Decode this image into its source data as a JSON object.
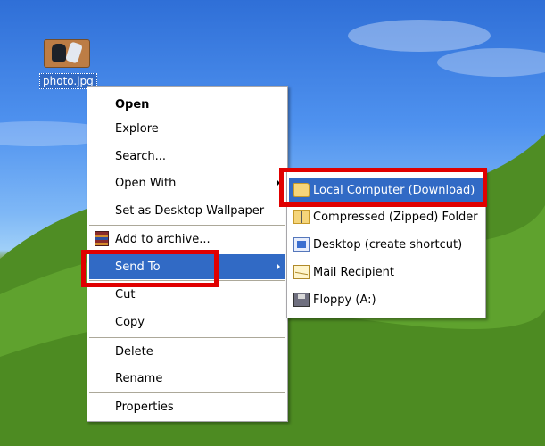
{
  "desktop_icon": {
    "label": "photo.jpg",
    "icon": "photo-thumbnail-icon"
  },
  "context_menu": {
    "items": [
      {
        "label": "Open",
        "bold": true
      },
      {
        "label": "Explore"
      },
      {
        "label": "Search..."
      },
      {
        "label": "Open With",
        "submenu": true
      },
      {
        "label": "Set as Desktop Wallpaper"
      },
      {
        "label": "Add to archive...",
        "icon": "winrar-archive-icon"
      },
      {
        "label": "Send To",
        "submenu": true,
        "highlighted": true
      },
      {
        "label": "Cut"
      },
      {
        "label": "Copy"
      },
      {
        "label": "Delete"
      },
      {
        "label": "Rename"
      },
      {
        "label": "Properties"
      }
    ]
  },
  "send_to_menu": {
    "items": [
      {
        "label": "Local Computer (Download)",
        "icon": "folder-icon",
        "highlighted": true
      },
      {
        "label": "Compressed (Zipped) Folder",
        "icon": "zip-folder-icon"
      },
      {
        "label": "Desktop (create shortcut)",
        "icon": "desktop-icon"
      },
      {
        "label": "Mail Recipient",
        "icon": "mail-icon"
      },
      {
        "label": "Floppy (A:)",
        "icon": "floppy-drive-icon"
      }
    ]
  },
  "colors": {
    "highlight": "#316ac5",
    "annotation_red": "#e00000",
    "menu_background": "#ffffff"
  }
}
